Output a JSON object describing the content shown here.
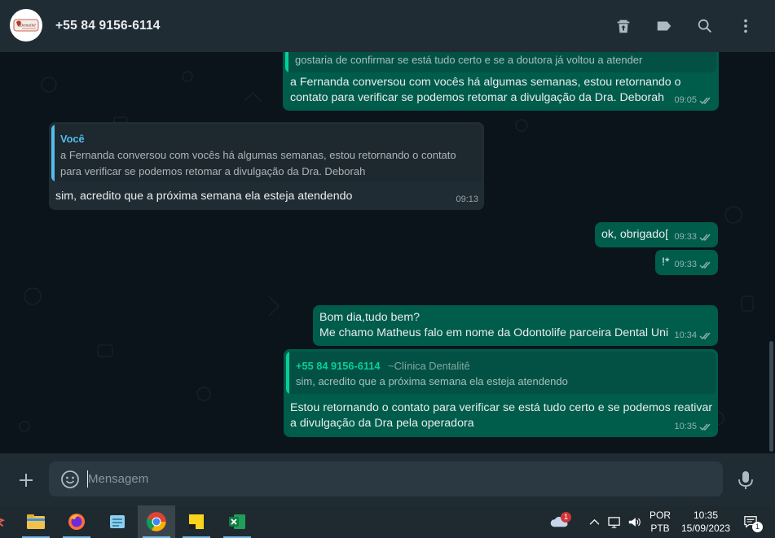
{
  "header": {
    "contact_name": "+55 84 9156-6114",
    "avatar_text": "Dentalitê",
    "icons": [
      "trash-icon",
      "label-icon",
      "search-icon",
      "more-vert-icon"
    ]
  },
  "messages": [
    {
      "direction": "out",
      "quote_text": "gostaria de confirmar se está tudo certo e se a doutora já voltou a atender",
      "text": "a Fernanda conversou com vocês há algumas semanas, estou retornando o\ncontato para verificar se podemos retomar a divulgação da Dra. Deborah",
      "time": "09:05",
      "status": "read"
    },
    {
      "direction": "in",
      "quote_author": "Você",
      "quote_text": "a Fernanda conversou com vocês há algumas semanas, estou retornando o contato\npara verificar se podemos retomar a divulgação da Dra. Deborah",
      "text": "sim, acredito que a próxima semana ela esteja atendendo",
      "time": "09:13"
    },
    {
      "direction": "out",
      "text": "ok, obrigado[",
      "time": "09:33",
      "status": "read"
    },
    {
      "direction": "out",
      "text": "!*",
      "time": "09:33",
      "status": "read"
    },
    {
      "direction": "out",
      "text": "Bom dia,tudo bem?\nMe chamo Matheus falo em nome da Odontolife parceira Dental Uni",
      "time": "10:34",
      "status": "read"
    },
    {
      "direction": "out",
      "quote_author": "+55 84 9156-6114",
      "quote_author_sub": "~Clínica Dentalitê",
      "quote_text": "sim, acredito que a próxima semana ela esteja atendendo",
      "text": "Estou retornando o contato para verificar se está tudo certo e se podemos reativar\na divulgação da Dra pela operadora",
      "time": "10:35",
      "status": "read"
    }
  ],
  "composer": {
    "placeholder": "Mensagem",
    "value": ""
  },
  "taskbar": {
    "apps": [
      "pinned-app-icon",
      "file-explorer-icon",
      "firefox-icon",
      "notepad-icon",
      "chrome-icon",
      "sticky-notes-icon",
      "excel-icon"
    ],
    "active_app": "chrome-icon",
    "weather_badge": "1",
    "lang_line1": "POR",
    "lang_line2": "PTB",
    "time": "10:35",
    "date": "15/09/2023",
    "notification_count": "1"
  },
  "colors": {
    "header_bg": "#202c33",
    "chat_bg": "#0b141a",
    "bubble_out": "#005c4b",
    "bubble_in": "#202c33",
    "quote_bar_self": "#53bdeb",
    "quote_bar_contact": "#06cf9c",
    "taskbar_bg": "#1f2a30"
  }
}
